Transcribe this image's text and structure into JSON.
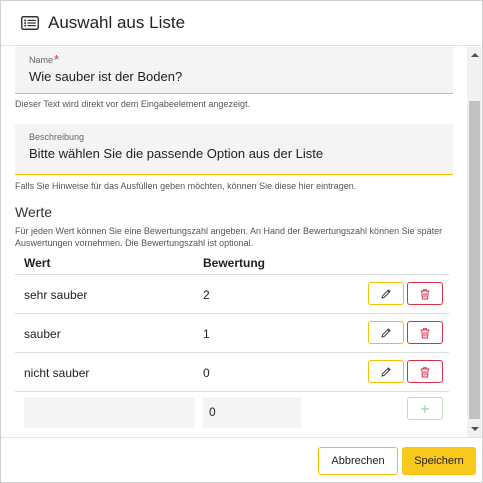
{
  "dialog": {
    "title": "Auswahl aus Liste",
    "title_icon": "list-icon"
  },
  "name_field": {
    "label": "Name",
    "required_mark": "*",
    "value": "Wie sauber ist der Boden?",
    "hint": "Dieser Text wird direkt vor dem Eingabeelement angezeigt."
  },
  "description_field": {
    "label": "Beschreibung",
    "value": "Bitte wählen Sie die passende Option aus der Liste",
    "hint": "Falls Sie Hinweise für das Ausfüllen geben möchten, können Sie diese hier eintragen."
  },
  "values_section": {
    "title": "Werte",
    "description": "Für jeden Wert können Sie eine Bewertungszahl angeben. An Hand der Bewertungszahl können Sie später Auswertungen vornehmen. Die Bewertungszahl ist optional.",
    "columns": [
      "Wert",
      "Bewertung"
    ],
    "rows": [
      {
        "wert": "sehr sauber",
        "bewertung": "2"
      },
      {
        "wert": "sauber",
        "bewertung": "1"
      },
      {
        "wert": "nicht sauber",
        "bewertung": "0"
      }
    ],
    "new_row": {
      "wert": "",
      "bewertung": "0"
    },
    "row_actions": {
      "edit_icon": "pencil-icon",
      "delete_icon": "trash-icon"
    },
    "add_icon": "plus-icon"
  },
  "footer": {
    "cancel_label": "Abbrechen",
    "save_label": "Speichern"
  },
  "colors": {
    "accent_yellow": "#f8c81c",
    "danger_red": "#d9304a",
    "success_green": "#7bc47b",
    "field_bg": "#f4f4f4"
  }
}
